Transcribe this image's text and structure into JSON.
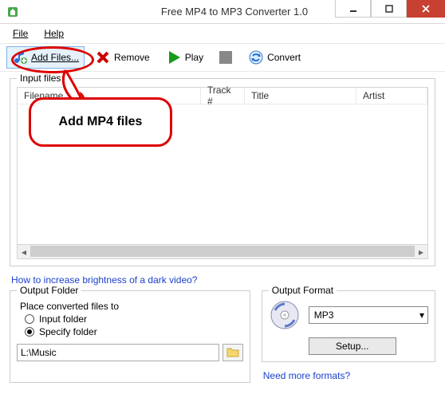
{
  "window": {
    "title": "Free MP4 to MP3 Converter 1.0"
  },
  "menu": {
    "file": "File",
    "help": "Help"
  },
  "toolbar": {
    "add": "Add Files...",
    "remove": "Remove",
    "play": "Play",
    "convert": "Convert"
  },
  "input": {
    "legend": "Input files",
    "columns": {
      "filename": "Filename",
      "track": "Track #",
      "title": "Title",
      "artist": "Artist"
    }
  },
  "link_brightness": "How to increase brightness of a dark video?",
  "output_folder": {
    "legend": "Output Folder",
    "place_label": "Place converted files to",
    "opt_input": "Input folder",
    "opt_specify": "Specify folder",
    "path": "L:\\Music"
  },
  "output_format": {
    "legend": "Output Format",
    "selected": "MP3",
    "setup": "Setup...",
    "more_link": "Need more formats?"
  },
  "callout": {
    "text": "Add MP4 files"
  }
}
